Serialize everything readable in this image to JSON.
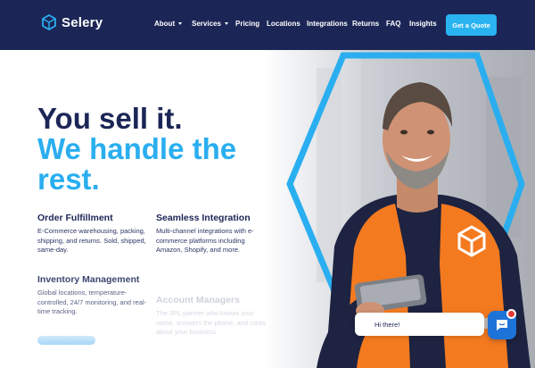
{
  "header": {
    "brand": "Selery",
    "nav": [
      {
        "label": "About",
        "dropdown": true
      },
      {
        "label": "Services",
        "dropdown": true
      },
      {
        "label": "Pricing",
        "dropdown": false
      },
      {
        "label": "Locations",
        "dropdown": false
      },
      {
        "label": "Integrations",
        "dropdown": false
      },
      {
        "label": "Returns",
        "dropdown": false
      },
      {
        "label": "FAQ",
        "dropdown": false
      },
      {
        "label": "Insights",
        "dropdown": false
      }
    ],
    "cta_label": "Get a Quote"
  },
  "hero": {
    "headline_line1": "You sell it.",
    "headline_line2": "We handle the",
    "headline_line3": "rest."
  },
  "features": [
    {
      "title": "Order Fulfillment",
      "text": "E-Commerce warehousing, packing, shipping, and returns. Sold, shipped, same-day."
    },
    {
      "title": "Seamless Integration",
      "text": "Multi-channel integrations with e-commerce platforms including Amazon, Shopify, and more."
    },
    {
      "title": "Inventory Management",
      "text": "Global locations, temperature-controlled, 24/7 monitoring, and real-time tracking."
    },
    {
      "title": "Account Managers",
      "text": "The 3PL partner who knows your name, answers the phone, and cares about your business."
    }
  ],
  "chat": {
    "greeting": "Hi there!"
  },
  "colors": {
    "navy": "#1c2656",
    "accent": "#2aaef0",
    "vest": "#f47a20",
    "chat": "#1e73d8"
  }
}
